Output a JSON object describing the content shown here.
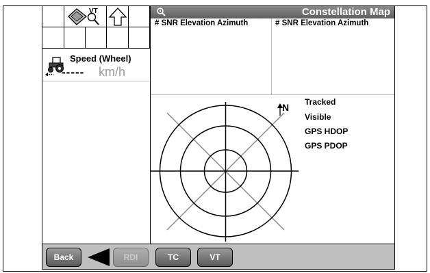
{
  "header": {
    "title": "Constellation Map",
    "info_icon": "info-magnifier-icon"
  },
  "toolbar": {
    "vt_label": "VT",
    "icons": [
      "display-settings-icon",
      "search-icon",
      "up-arrow-icon"
    ]
  },
  "speed": {
    "title": "Speed (Wheel)",
    "value": "-----",
    "unit": "km/h",
    "icon": "tractor-icon"
  },
  "satellite_table": {
    "columns_left": "#  SNR  Elevation  Azimuth",
    "columns_right": "#  SNR  Elevation  Azimuth"
  },
  "map": {
    "north_label": "N",
    "legend": [
      "Tracked",
      "Visible",
      "GPS HDOP",
      "GPS PDOP"
    ]
  },
  "bottom_bar": {
    "back_label": "Back",
    "rdi_label": "RDI",
    "tc_label": "TC",
    "vt_label": "VT"
  }
}
